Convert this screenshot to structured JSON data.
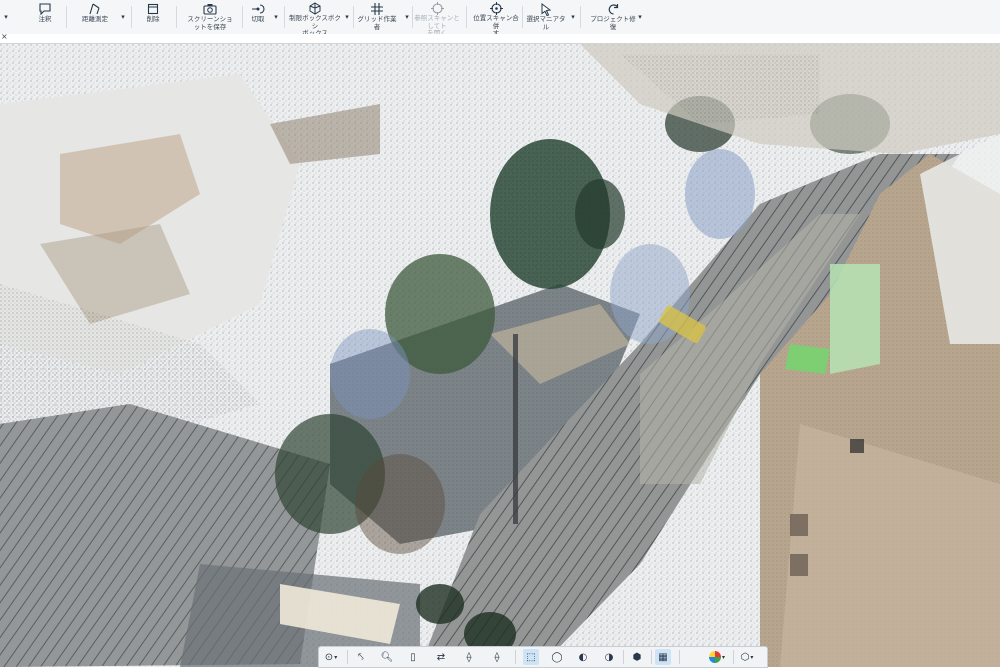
{
  "ribbon": {
    "items": [
      {
        "label": "注釈",
        "icon": "annotation-icon"
      },
      {
        "label": "距離測定",
        "icon": "measure-icon"
      },
      {
        "label": "削除",
        "icon": "delete-icon"
      },
      {
        "label": "スクリーンショ\nットを保存",
        "icon": "camera-icon"
      },
      {
        "label": "切取",
        "icon": "clip-icon"
      },
      {
        "label": "制限ボックスボクシ\nボックス",
        "icon": "clipping-box-icon"
      },
      {
        "label": "グリッド作業者",
        "icon": "grid-icon"
      },
      {
        "label": "参照スキャンとしてト\nを開く",
        "icon": "reference-scan-icon"
      },
      {
        "label": "位置スキャン合併\nす",
        "icon": "position-icon"
      },
      {
        "label": "選択マニアタル",
        "icon": "select-icon"
      },
      {
        "label": "プロジェクト修復",
        "icon": "project-icon"
      }
    ]
  },
  "tab": {
    "close_symbol": "×"
  },
  "bottom_toolbar": {
    "buttons": [
      {
        "icon": "compass-icon",
        "symbol": "⊙"
      },
      {
        "icon": "transform-icon",
        "symbol": "⤣"
      },
      {
        "icon": "zoom-icon",
        "symbol": "🔍︎"
      },
      {
        "icon": "page-icon",
        "symbol": "▯"
      },
      {
        "icon": "pan-icon",
        "symbol": "⇄"
      },
      {
        "icon": "node-icon",
        "symbol": "⟠"
      },
      {
        "icon": "cube-view-icon",
        "symbol": "⬚"
      },
      {
        "icon": "orbit-icon",
        "symbol": "◯"
      },
      {
        "icon": "half-circle-icon",
        "symbol": "◐"
      },
      {
        "icon": "contrast-icon",
        "symbol": "◑"
      },
      {
        "icon": "cube-icon",
        "symbol": "⬢"
      },
      {
        "icon": "grid-view-icon",
        "symbol": "▦"
      },
      {
        "icon": "color-wheel-icon",
        "symbol": "●"
      },
      {
        "icon": "tool-icon",
        "symbol": "⬡"
      }
    ]
  },
  "colors": {
    "toolbar_bg": "#f4f6f8",
    "accent": "#3a7bd5",
    "active_bg": "#cfe3f6"
  }
}
